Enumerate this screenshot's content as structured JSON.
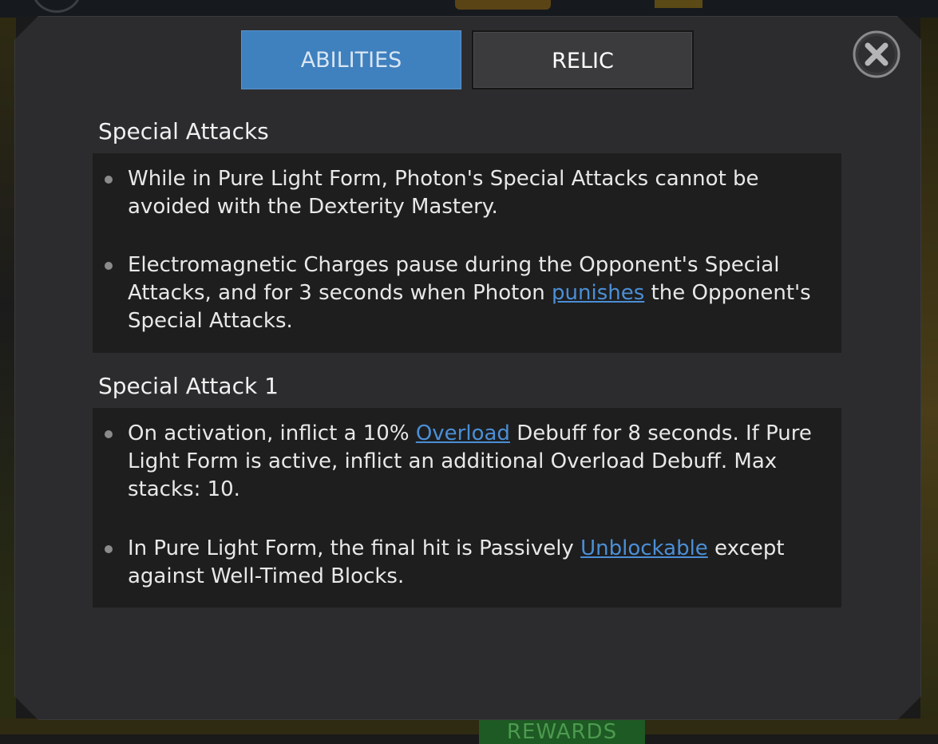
{
  "tabs": {
    "abilities": "ABILITIES",
    "relic": "RELIC"
  },
  "background": {
    "rewards_label": "REWARDS"
  },
  "sections": [
    {
      "title": "Special Attacks",
      "bullets": [
        {
          "text": "While in Pure Light Form, Photon's Special Attacks cannot be avoided with the Dexterity Mastery."
        },
        {
          "pre": "Electromagnetic Charges pause during the Opponent's Special Attacks, and for 3 seconds when Photon ",
          "link": "punishes",
          "post": " the Opponent's Special Attacks."
        }
      ]
    },
    {
      "title": "Special Attack 1",
      "bullets": [
        {
          "pre": "On activation, inflict a 10% ",
          "link": "Overload",
          "post": " Debuff for 8 seconds. If Pure Light Form is active, inflict an additional Overload Debuff. Max stacks: 10."
        },
        {
          "pre": "In Pure Light Form, the final hit is Passively ",
          "link": "Unblockable",
          "post": " except against Well-Timed Blocks."
        }
      ]
    }
  ],
  "icons": {
    "close": "close-icon",
    "bullet": "bullet-dot-icon"
  },
  "colors": {
    "active_tab": "#3f80be",
    "link": "#4b8fd6",
    "panel": "#2c2c2e",
    "content_box": "#1e1e1f"
  }
}
